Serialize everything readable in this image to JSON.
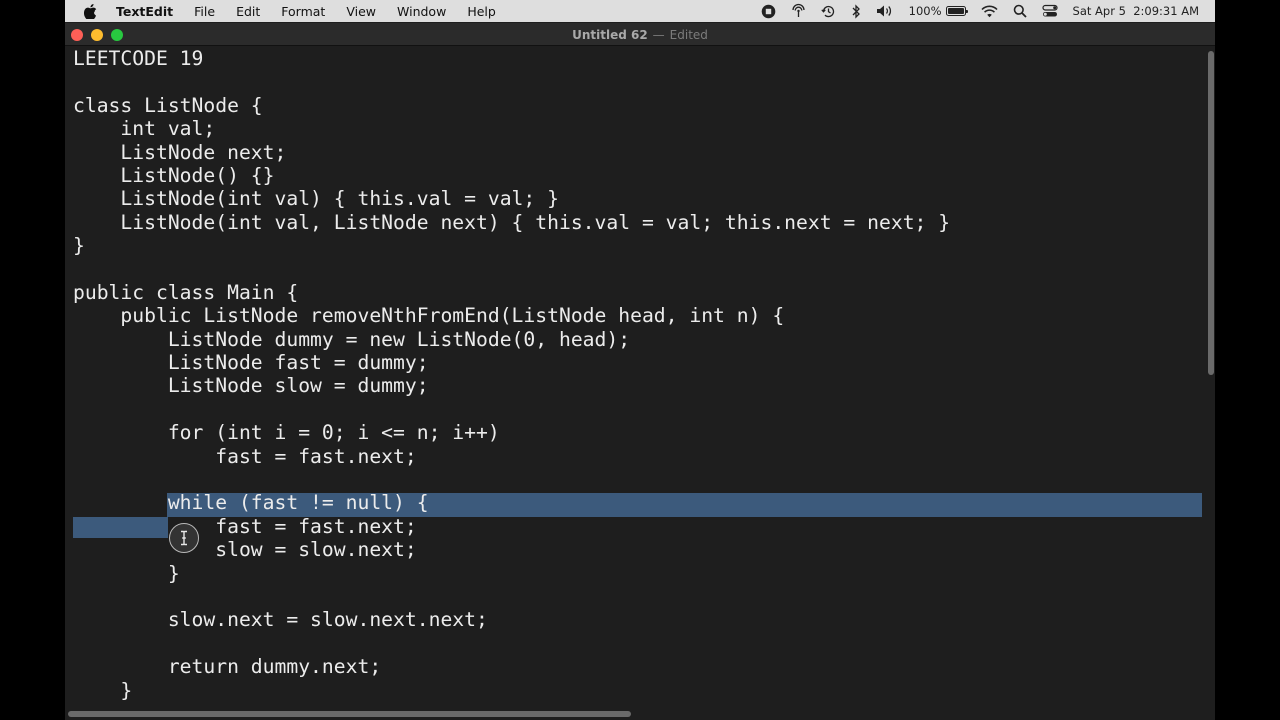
{
  "menubar": {
    "app_name": "TextEdit",
    "menus": [
      "File",
      "Edit",
      "Format",
      "View",
      "Window",
      "Help"
    ],
    "status": {
      "battery_percent": "100%",
      "battery_level": 1.0,
      "datetime": "Sat Apr 5  2:09:31 AM"
    }
  },
  "window": {
    "doc_name": "Untitled 62",
    "separator": "—",
    "state": "Edited"
  },
  "editor": {
    "lines": [
      "LEETCODE 19",
      "",
      "class ListNode {",
      "    int val;",
      "    ListNode next;",
      "    ListNode() {}",
      "    ListNode(int val) { this.val = val; }",
      "    ListNode(int val, ListNode next) { this.val = val; this.next = next; }",
      "}",
      "",
      "public class Main {",
      "    public ListNode removeNthFromEnd(ListNode head, int n) {",
      "        ListNode dummy = new ListNode(0, head);",
      "        ListNode fast = dummy;",
      "        ListNode slow = dummy;",
      "",
      "        for (int i = 0; i <= n; i++)",
      "            fast = fast.next;",
      "",
      "        while (fast != null) {",
      "            fast = fast.next;",
      "            slow = slow.next;",
      "        }",
      "",
      "        slow.next = slow.next.next;",
      "",
      "        return dummy.next;",
      "    }"
    ]
  },
  "colors": {
    "editor_bg": "#1e1e1e",
    "text": "#ececec",
    "selection": "#3c5a7c",
    "close": "#fe5f57",
    "minimize": "#febc2e",
    "zoom": "#28c840"
  }
}
